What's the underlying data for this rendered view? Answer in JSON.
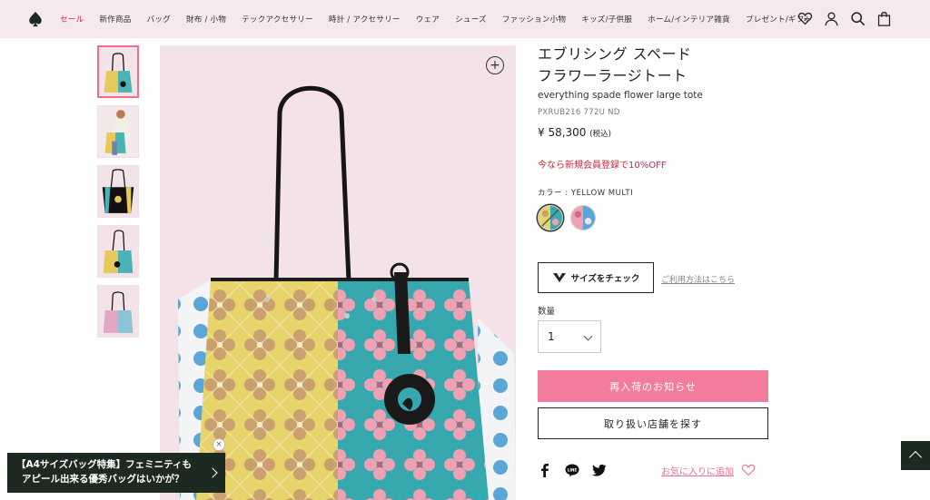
{
  "nav": {
    "items": [
      {
        "label": "セール",
        "sale": true
      },
      {
        "label": "新作商品"
      },
      {
        "label": "バッグ"
      },
      {
        "label": "財布 / 小物"
      },
      {
        "label": "テックアクセサリー"
      },
      {
        "label": "時計 / アクセサリー"
      },
      {
        "label": "ウェア"
      },
      {
        "label": "シューズ"
      },
      {
        "label": "ファッション小物"
      },
      {
        "label": "キッズ/子供服"
      },
      {
        "label": "ホーム/インテリア雑貨"
      },
      {
        "label": "プレゼント/ギフト"
      }
    ],
    "icons": [
      "wishlist-heart-icon",
      "account-icon",
      "search-icon",
      "cart-bag-icon"
    ]
  },
  "product": {
    "title_line1": "エブリシング スペード",
    "title_line2": "フラワーラージトート",
    "subtitle": "everything spade flower large tote",
    "sku": "PXRUB216 772U ND",
    "price": "¥ 58,300",
    "price_tax": "(税込)",
    "promo": "今なら新規会員登録で10%OFF",
    "color_label": "カラー : YELLOW MULTI",
    "size_check": "サイズをチェック",
    "how_to_use": "ご利用方法はこちら",
    "quantity_label": "数量",
    "quantity_value": "1",
    "restock_button": "再入荷のお知らせ",
    "store_button": "取り扱い店舗を探す",
    "favorite_link": "お気に入りに追加"
  },
  "thumbnails": 5,
  "banner": {
    "line1": "【A4サイズバッグ特集】フェミニティも",
    "line2": "アピール出来る優秀バッグはいかが？"
  },
  "colors": {
    "accent_pink": "#f37b9b",
    "sale_red": "#d2233b",
    "header_bg": "#f6e9ee",
    "banner_bg": "#1d2a22"
  }
}
